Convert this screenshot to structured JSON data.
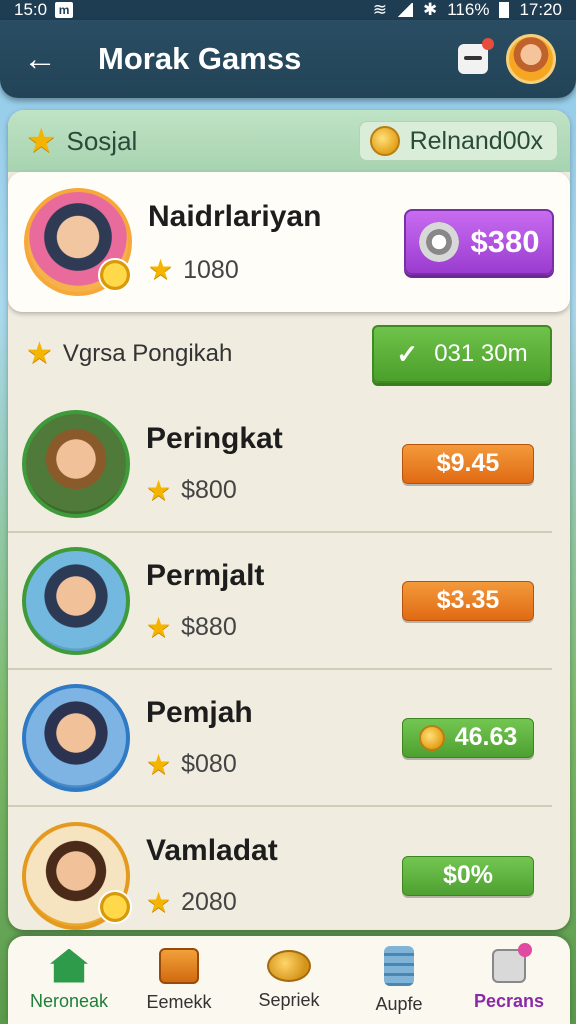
{
  "status_bar": {
    "time_left": "15:0",
    "app_badge": "m",
    "battery": "116%",
    "time_right": "17:20"
  },
  "header": {
    "title": "Morak Gamss"
  },
  "section": {
    "title": "Sosjal",
    "reward": "Relnand00x"
  },
  "featured": {
    "name": "Naidrlariyan",
    "score": "1080",
    "price": "$380"
  },
  "ranking": {
    "title": "Vgrsa Pongikah",
    "timer": "031 30m"
  },
  "players": [
    {
      "name": "Peringkat",
      "score": "$800",
      "price": "$9.45",
      "price_style": "orange"
    },
    {
      "name": "Permjalt",
      "score": "$880",
      "price": "$3.35",
      "price_style": "orange"
    },
    {
      "name": "Pemjah",
      "score": "$080",
      "price": "46.63",
      "price_style": "green"
    },
    {
      "name": "Vamladat",
      "score": "2080",
      "price": "$0%",
      "price_style": "green"
    }
  ],
  "bottom_nav": [
    {
      "label": "Neroneak"
    },
    {
      "label": "Eemekk"
    },
    {
      "label": "Sepriek"
    },
    {
      "label": "Aupfe"
    },
    {
      "label": "Pecrans"
    }
  ],
  "colors": {
    "header": "#234457",
    "purple_button": "#9b3cd0",
    "green_button": "#4ba02b",
    "orange_tag": "#e06a14"
  }
}
